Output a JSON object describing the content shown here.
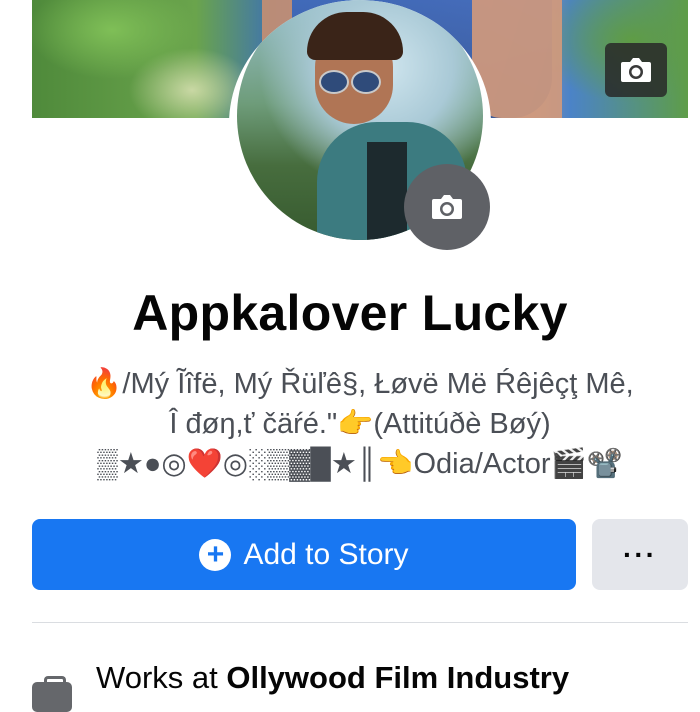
{
  "profile": {
    "name": "Appkalover Lucky",
    "bio_line1": "🔥/Mý Ĩîfë, Mý Řüľê§, Łøvë Më Ŕêjêçţ Mê,",
    "bio_line2": "Î đøŋ,ť čäŕé.\"👉(Attitúðè Bøý)",
    "bio_line3": "▒★●◎❤️◎░▒▓█★║👈Odia/Actor🎬📽️"
  },
  "actions": {
    "add_story_label": "Add to Story",
    "plus_symbol": "+",
    "more_label": "···"
  },
  "intro": {
    "works_prefix": "Works at ",
    "works_place": "Ollywood Film Industry"
  },
  "icons": {
    "cover_camera": "camera-icon",
    "avatar_camera": "camera-icon",
    "work": "briefcase-icon"
  },
  "colors": {
    "primary": "#1877f2",
    "secondary_button": "#e4e6eb",
    "text": "#050505",
    "muted_text": "#4b4f56"
  }
}
